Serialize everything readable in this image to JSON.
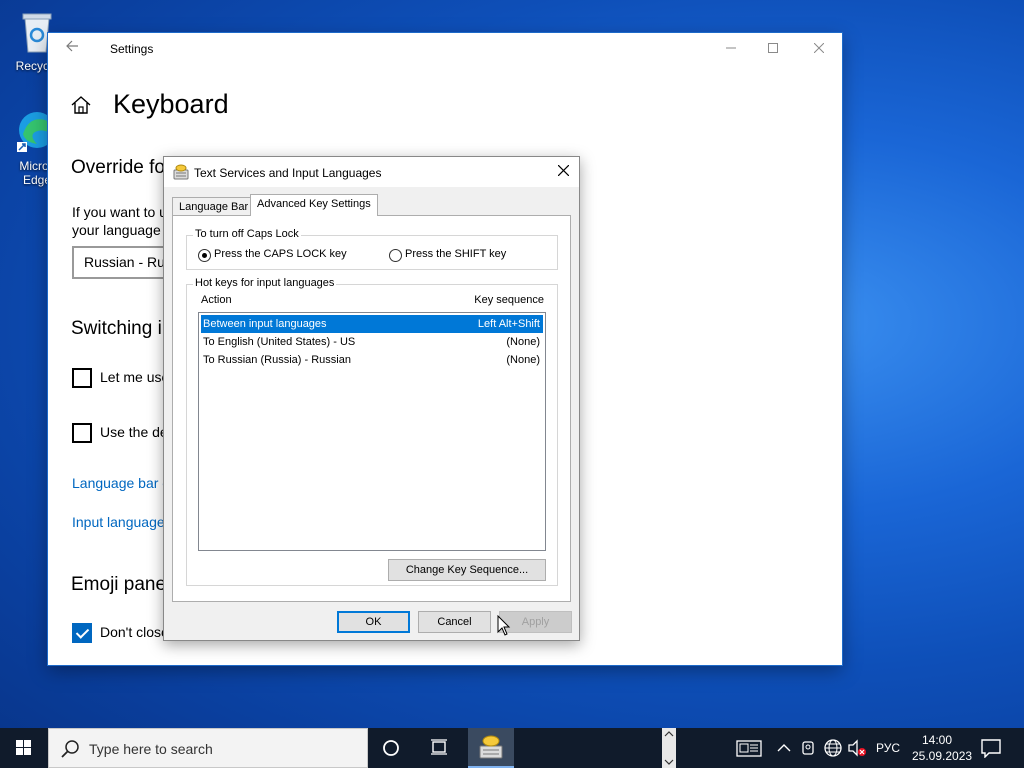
{
  "desktop": {
    "icons": [
      {
        "label": "Recycle"
      },
      {
        "label": "Micros\nEdge"
      }
    ]
  },
  "settings": {
    "title": "Settings",
    "heading": "Keyboard",
    "override_heading": "Override fo",
    "override_text": "If you want to u\nyour language",
    "dropdown_value": "Russian - Rus",
    "switching_heading": "Switching i",
    "check1_label": "Let me use",
    "check2_label": "Use the de",
    "link_language_bar": "Language bar o",
    "link_input_language": "Input language",
    "emoji_heading": "Emoji pane",
    "check3_label": "Don't close"
  },
  "dialog": {
    "title": "Text Services and Input Languages",
    "tabs": [
      {
        "label": "Language Bar",
        "active": false
      },
      {
        "label": "Advanced Key Settings",
        "active": true
      }
    ],
    "caps_group_label": "To turn off Caps Lock",
    "radio_caps": "Press the CAPS LOCK key",
    "radio_shift": "Press the SHIFT key",
    "hotkeys_group_label": "Hot keys for input languages",
    "col_action": "Action",
    "col_key": "Key sequence",
    "rows": [
      {
        "action": "Between input languages",
        "key": "Left Alt+Shift",
        "selected": true
      },
      {
        "action": "To English (United States) - US",
        "key": "(None)",
        "selected": false
      },
      {
        "action": "To Russian (Russia) - Russian",
        "key": "(None)",
        "selected": false
      }
    ],
    "change_key_button": "Change Key Sequence...",
    "ok_button": "OK",
    "cancel_button": "Cancel",
    "apply_button": "Apply"
  },
  "taskbar": {
    "search_placeholder": "Type here to search",
    "language": "РУС",
    "time": "14:00",
    "date": "25.09.2023"
  },
  "colors": {
    "accent": "#0078d7",
    "link": "#0067c0",
    "taskbar": "#101b2b"
  }
}
